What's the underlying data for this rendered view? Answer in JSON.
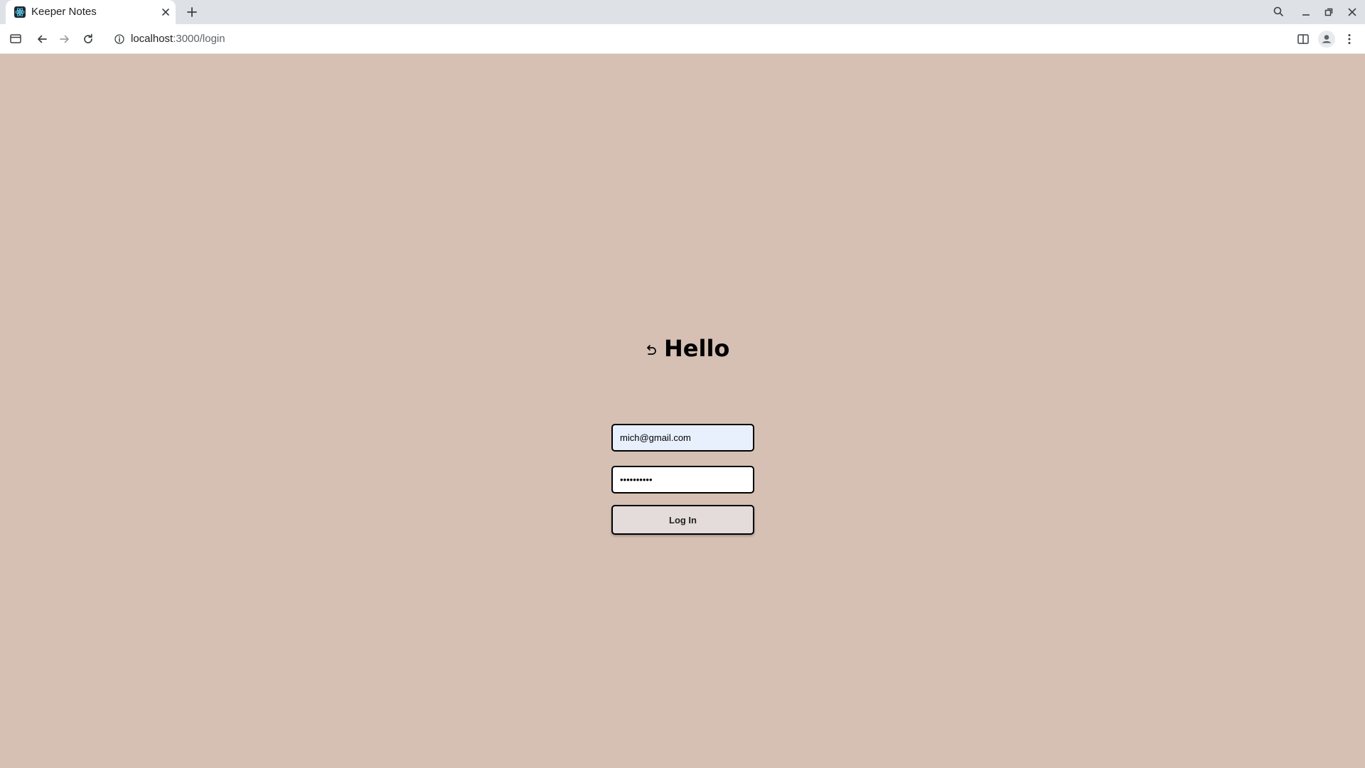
{
  "browser": {
    "tab": {
      "title": "Keeper Notes",
      "favicon": "react-logo-icon"
    },
    "address_bar": {
      "host": "localhost",
      "path": ":3000/login"
    },
    "icons": {
      "sidebar": "tab-search-sidebar-icon",
      "back": "arrow-left-icon",
      "forward": "arrow-right-icon",
      "reload": "reload-icon",
      "info": "info-icon",
      "split": "split-view-icon",
      "profile": "profile-icon",
      "menu": "kebab-menu-icon",
      "tab_search": "search-icon",
      "minimize": "minimize-icon",
      "restore": "restore-icon",
      "close": "close-icon"
    }
  },
  "login": {
    "heading": "Hello",
    "back_icon": "undo-arrow-icon",
    "email_value": "mich@gmail.com",
    "password_value": "••••••••••",
    "submit_label": "Log In"
  },
  "colors": {
    "page_background": "#d6c0b3",
    "email_autofill_background": "#e8f0fe",
    "button_background": "#e4dcda",
    "border": "#000000"
  }
}
